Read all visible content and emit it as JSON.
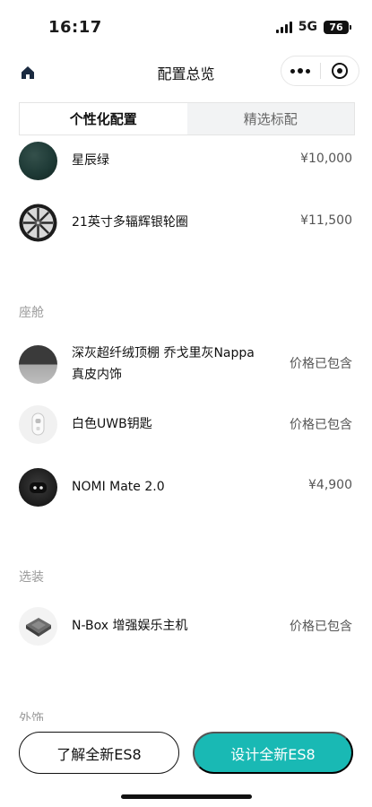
{
  "status": {
    "time": "16:17",
    "network": "5G",
    "battery": "76"
  },
  "nav": {
    "title": "配置总览"
  },
  "tabs": [
    {
      "label": "个性化配置",
      "active": true
    },
    {
      "label": "精选标配",
      "active": false
    }
  ],
  "items_top": [
    {
      "name": "星辰绿",
      "price": "¥10,000",
      "icon": "color-swatch-icon"
    },
    {
      "name": "21英寸多辐辉银轮圈",
      "price": "¥11,500",
      "icon": "wheel-icon"
    }
  ],
  "cabin": {
    "label": "座舱",
    "items": [
      {
        "name_line1": "深灰超纤绒顶棚 乔戈里灰Nappa",
        "name_line2": "真皮内饰",
        "price": "价格已包含",
        "icon": "interior-swatch-icon"
      },
      {
        "name": "白色UWB钥匙",
        "price": "价格已包含",
        "icon": "key-fob-icon"
      },
      {
        "name": "NOMI Mate 2.0",
        "price": "¥4,900",
        "icon": "nomi-robot-icon"
      }
    ]
  },
  "options": {
    "label": "选装",
    "items": [
      {
        "name": "N-Box 增强娱乐主机",
        "price": "价格已包含",
        "icon": "nbox-device-icon"
      }
    ]
  },
  "exterior_partial_label": "外饰",
  "buttons": {
    "learn": "了解全新ES8",
    "design": "设计全新ES8"
  },
  "colors": {
    "accent": "#19b9b4",
    "swatch_green": "#1e3a36"
  }
}
